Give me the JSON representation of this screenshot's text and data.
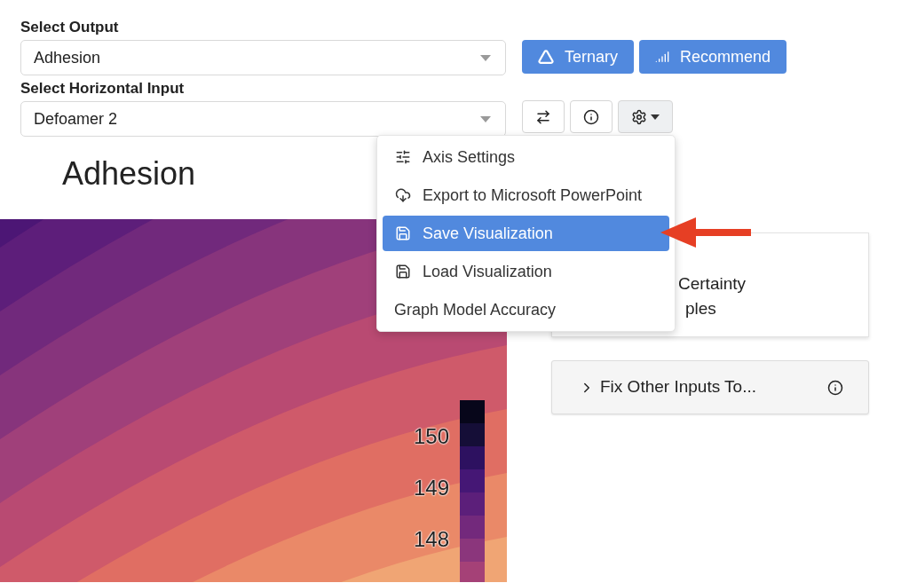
{
  "output_select": {
    "label": "Select Output",
    "value": "Adhesion"
  },
  "actions": [
    {
      "label": "Ternary",
      "kind": "ternary"
    },
    {
      "label": "Recommend",
      "kind": "recommend"
    }
  ],
  "input_select": {
    "label": "Select Horizontal Input",
    "value": "Defoamer 2"
  },
  "toolbar": [
    {
      "kind": "swap"
    },
    {
      "kind": "info"
    },
    {
      "kind": "settings",
      "expanded": true
    }
  ],
  "plot": {
    "title": "Adhesion",
    "colorbar_ticks": [
      "150",
      "149",
      "148"
    ]
  },
  "menu": {
    "items": [
      {
        "label": "Axis Settings",
        "kind": "settings",
        "selected": false
      },
      {
        "label": "Export to Microsoft PowerPoint",
        "kind": "export",
        "selected": false
      },
      {
        "label": "Save Visualization",
        "kind": "save",
        "selected": true
      },
      {
        "label": "Load Visualization",
        "kind": "load",
        "selected": false
      },
      {
        "label": "Graph Model Accuracy",
        "kind": "plain",
        "selected": false
      }
    ]
  },
  "options_card": {
    "lines": [
      "Certainty",
      "ples"
    ]
  },
  "accordion": {
    "label": "Fix Other Inputs To...",
    "expanded": false
  }
}
